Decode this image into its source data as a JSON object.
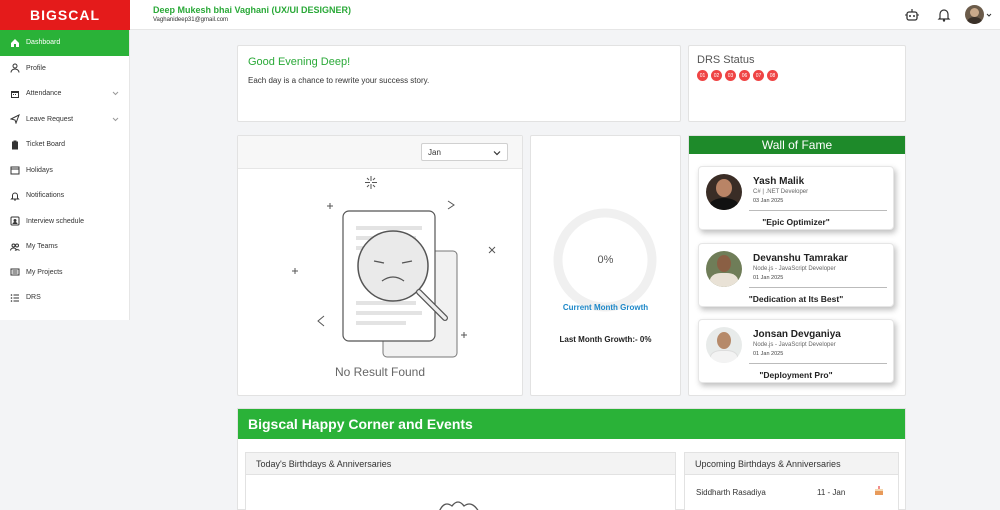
{
  "brand": {
    "logo": "BIGSCAL",
    "accent": "#2ab238",
    "brand_red": "#e41b1b"
  },
  "header": {
    "user_name": "Deep Mukesh bhai Vaghani (UX/UI DESIGNER)",
    "user_email": "Vaghanideep31@gmail.com",
    "icons": [
      "robot-icon",
      "bell-icon",
      "avatar"
    ]
  },
  "sidebar": {
    "items": [
      {
        "label": "Dashboard",
        "icon": "home-icon",
        "active": true
      },
      {
        "label": "Profile",
        "icon": "user-icon"
      },
      {
        "label": "Attendance",
        "icon": "calendar-icon",
        "has_submenu": true
      },
      {
        "label": "Leave Request",
        "icon": "send-icon",
        "has_submenu": true
      },
      {
        "label": "Ticket Board",
        "icon": "clipboard-icon"
      },
      {
        "label": "Holidays",
        "icon": "holiday-icon"
      },
      {
        "label": "Notifications",
        "icon": "bell-icon"
      },
      {
        "label": "Interview schedule",
        "icon": "interview-icon"
      },
      {
        "label": "My Teams",
        "icon": "team-icon"
      },
      {
        "label": "My Projects",
        "icon": "project-icon"
      },
      {
        "label": "DRS",
        "icon": "list-icon"
      }
    ]
  },
  "greeting": {
    "title": "Good Evening Deep!",
    "subtitle": "Each day is a chance to rewrite your success story."
  },
  "drs": {
    "title": "DRS Status",
    "days": [
      "01",
      "02",
      "03",
      "06",
      "07",
      "08"
    ]
  },
  "month_filter": {
    "selected": "Jan"
  },
  "empty_state": {
    "text": "No Result Found"
  },
  "growth": {
    "percent_label": "0%",
    "current_label": "Current Month Growth",
    "last_label": "Last Month Growth:- 0%"
  },
  "wall_of_fame": {
    "title": "Wall of Fame",
    "entries": [
      {
        "name": "Yash Malik",
        "role": "C# | .NET Developer",
        "date": "03 Jan 2025",
        "title": "\"Epic Optimizer\""
      },
      {
        "name": "Devanshu Tamrakar",
        "role": "Node.js - JavaScript Developer",
        "date": "01 Jan 2025",
        "title": "\"Dedication at Its Best\""
      },
      {
        "name": "Jonsan Devganiya",
        "role": "Node.js - JavaScript Developer",
        "date": "01 Jan 2025",
        "title": "\"Deployment Pro\""
      }
    ]
  },
  "happy_corner": {
    "title": "Bigscal Happy Corner and Events",
    "today_title": "Today's Birthdays & Anniversaries",
    "upcoming_title": "Upcoming Birthdays & Anniversaries",
    "upcoming": [
      {
        "name": "Siddharth Rasadiya",
        "date": "11 - Jan",
        "type": "cake-icon"
      }
    ]
  }
}
